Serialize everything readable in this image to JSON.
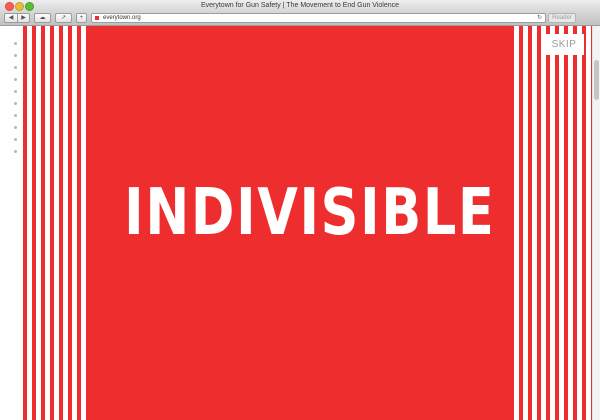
{
  "window": {
    "title": "Everytown for Gun Safety | The Movement to End Gun Violence"
  },
  "toolbar": {
    "back_icon": "◀",
    "forward_icon": "▶",
    "cloud_icon": "☁",
    "share_icon": "↗",
    "add_icon": "+",
    "url": "everytown.org",
    "reload_icon": "↻",
    "reader_label": "Reader"
  },
  "page": {
    "headline": "INDIVISIBLE",
    "skip_label": "SKIP",
    "nav_dot_count": 10
  },
  "colors": {
    "brand_red": "#ee2e2e",
    "background": "#ffffff"
  }
}
